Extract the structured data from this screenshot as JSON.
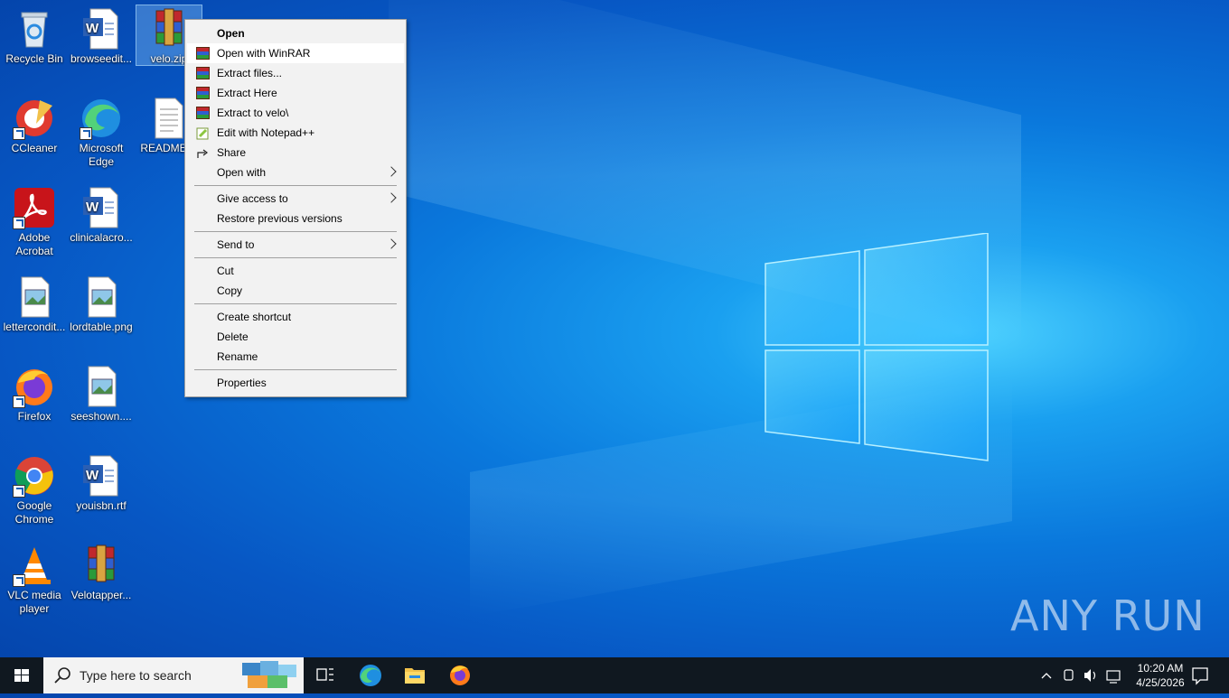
{
  "desktop": {
    "icons": [
      {
        "label": "Recycle Bin",
        "icon": "recycle-bin-icon"
      },
      {
        "label": "browseedit...",
        "icon": "word-doc-icon"
      },
      {
        "label": "velo.zip",
        "icon": "winrar-archive-icon",
        "selected": true
      },
      {
        "label": "CCleaner",
        "icon": "ccleaner-icon"
      },
      {
        "label": "Microsoft Edge",
        "icon": "edge-icon"
      },
      {
        "label": "README...",
        "icon": "text-file-icon"
      },
      {
        "label": "Adobe Acrobat",
        "icon": "acrobat-icon"
      },
      {
        "label": "clinicalacro...",
        "icon": "word-doc-icon"
      },
      {
        "label": "lettercondit...",
        "icon": "image-file-icon"
      },
      {
        "label": "lordtable.png",
        "icon": "image-file-icon"
      },
      {
        "label": "Firefox",
        "icon": "firefox-icon"
      },
      {
        "label": "seeshown....",
        "icon": "image-file-icon"
      },
      {
        "label": "Google Chrome",
        "icon": "chrome-icon"
      },
      {
        "label": "youisbn.rtf",
        "icon": "word-doc-icon"
      },
      {
        "label": "VLC media player",
        "icon": "vlc-icon"
      },
      {
        "label": "Velotapper...",
        "icon": "winrar-archive-icon"
      }
    ]
  },
  "context_menu": {
    "items": [
      {
        "label": "Open",
        "bold": true
      },
      {
        "label": "Open with WinRAR",
        "icon": "winrar-icon",
        "highlighted": true
      },
      {
        "label": "Extract files...",
        "icon": "winrar-icon"
      },
      {
        "label": "Extract Here",
        "icon": "winrar-icon"
      },
      {
        "label": "Extract to velo\\",
        "icon": "winrar-icon"
      },
      {
        "label": "Edit with Notepad++",
        "icon": "notepadpp-icon"
      },
      {
        "label": "Share",
        "icon": "share-icon"
      },
      {
        "label": "Open with",
        "submenu": true
      },
      {
        "label": "Give access to",
        "submenu": true
      },
      {
        "label": "Restore previous versions"
      },
      {
        "label": "Send to",
        "submenu": true
      },
      {
        "label": "Cut"
      },
      {
        "label": "Copy"
      },
      {
        "label": "Create shortcut"
      },
      {
        "label": "Delete"
      },
      {
        "label": "Rename"
      },
      {
        "label": "Properties"
      }
    ]
  },
  "taskbar": {
    "search_placeholder": "Type here to search",
    "time": "10:20 AM",
    "date": "4/25/2026"
  },
  "watermark": "ANY RUN",
  "colors": {
    "accent": "#0a78dc",
    "taskbar": "#101820",
    "menu_bg": "#f2f2f2"
  }
}
